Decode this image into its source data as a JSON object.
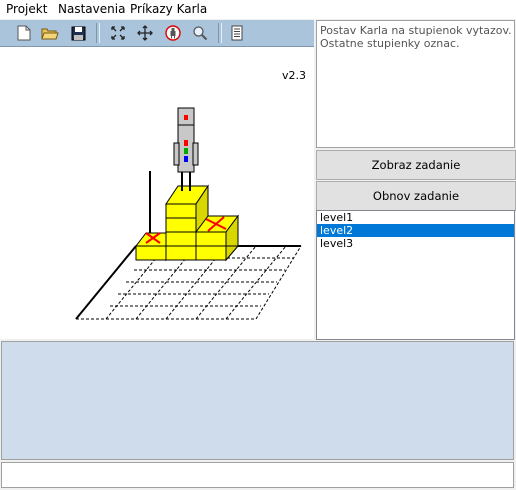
{
  "menu": {
    "items": [
      "Projekt",
      "Nastavenia",
      "Príkazy Karla"
    ]
  },
  "toolbar": {
    "buttons": [
      {
        "name": "new-file-icon"
      },
      {
        "name": "open-folder-icon"
      },
      {
        "name": "save-icon"
      },
      {
        "name": "zoom-fit-icon"
      },
      {
        "name": "move-icon"
      },
      {
        "name": "karel-icon"
      },
      {
        "name": "magnifier-icon"
      },
      {
        "name": "notes-icon"
      }
    ]
  },
  "canvas": {
    "version": "v2.3",
    "colors": {
      "block": "#ffff00",
      "mark": "#ff0000",
      "robot": "#c8c8c8"
    }
  },
  "task": {
    "text": "Postav Karla na stupienok vytazov. Ostatne stupienky oznac."
  },
  "buttons": {
    "show_task": "Zobraz zadanie",
    "renew_task": "Obnov zadanie"
  },
  "levels": {
    "items": [
      "level1",
      "level2",
      "level3"
    ],
    "selected": "level2"
  },
  "output": {
    "text": ""
  },
  "status": {
    "text": ""
  }
}
